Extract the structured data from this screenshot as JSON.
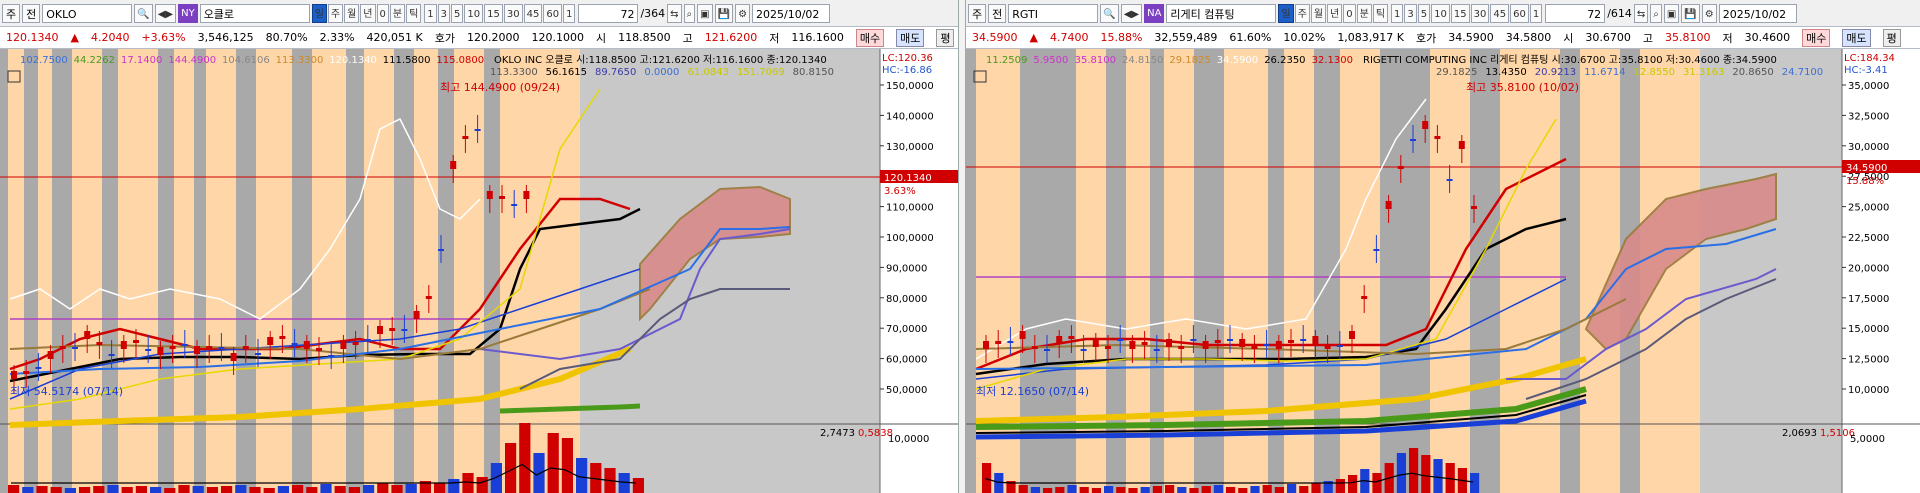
{
  "left": {
    "toolbar": {
      "period": "주",
      "market": "전",
      "symbol": "OKLO",
      "exchange_tag": "NY",
      "stock_name": "오클로",
      "buttons": [
        "일",
        "주",
        "월",
        "년",
        "0",
        "분",
        "틱"
      ],
      "intervals": [
        "1",
        "3",
        "5",
        "10",
        "15",
        "30",
        "45",
        "60",
        "1"
      ],
      "count": "72",
      "total": "/364",
      "date": "2025/10/02"
    },
    "quote": {
      "price": "120.1340",
      "change": "4.2040",
      "change_pct": "+3.63%",
      "volume": "3,546,125",
      "ratio": "80.70%",
      "turnover": "2.33%",
      "amount": "420,051 K",
      "bid_label": "호가",
      "bid": "120.2000",
      "ask": "120.1000",
      "open_label": "시",
      "open": "118.8500",
      "high_label": "고",
      "high": "121.6200",
      "low_label": "저",
      "low": "116.1600",
      "buy": "매수",
      "sell": "매도",
      "flat": "평"
    },
    "legend_row1": {
      "items": [
        {
          "text": "102.7500",
          "color": "#3a6fd6"
        },
        {
          "text": "44.2262",
          "color": "#4a9a1a"
        },
        {
          "text": "17.1400",
          "color": "#cc33cc"
        },
        {
          "text": "144.4900",
          "color": "#cc33cc"
        },
        {
          "text": "104.6106",
          "color": "#888888"
        },
        {
          "text": "113.3300",
          "color": "#cc8a2a"
        },
        {
          "text": "120.1340",
          "color": "#ffffff"
        },
        {
          "text": "111.5800",
          "color": "#000000"
        },
        {
          "text": "115.0800",
          "color": "#d10000"
        }
      ],
      "title": "OKLO INC  오클로 시:118.8500 고:121.6200 저:116.1600 종:120.1340",
      "lc": "LC:120.36",
      "hc": "HC:-16.86"
    },
    "legend_row2": {
      "items": [
        {
          "text": "113.3300",
          "color": "#555555"
        },
        {
          "text": "56.1615",
          "color": "#000000"
        },
        {
          "text": "89.7650",
          "color": "#3a3aa8"
        },
        {
          "text": "0.0000",
          "color": "#3a6fd6"
        },
        {
          "text": "61.0843",
          "color": "#c8c800"
        },
        {
          "text": "151.7069",
          "color": "#c8c800"
        },
        {
          "text": "80.8150",
          "color": "#555555"
        }
      ]
    },
    "max_label": "최고 144.4900 (09/24)",
    "min_label": "최저 54.5174 (07/14)",
    "price_tag": "120.1340",
    "price_pct": "3.63%",
    "y_ticks": [
      "150,0000",
      "140,0000",
      "130,0000",
      "120,0000",
      "110,0000",
      "100,0000",
      "90,0000",
      "80,0000",
      "70,0000",
      "60,0000",
      "50,0000"
    ],
    "vol_legend": [
      "2,7473",
      "0,5838"
    ],
    "vol_tick": "10,0000",
    "accent": "#d10000"
  },
  "right": {
    "toolbar": {
      "period": "주",
      "market": "전",
      "symbol": "RGTI",
      "exchange_tag": "NA",
      "stock_name": "리게티 컴퓨팅",
      "buttons": [
        "일",
        "주",
        "월",
        "년",
        "0",
        "분",
        "틱"
      ],
      "intervals": [
        "1",
        "3",
        "5",
        "10",
        "15",
        "30",
        "45",
        "60",
        "1"
      ],
      "count": "72",
      "total": "/614",
      "date": "2025/10/02"
    },
    "quote": {
      "price": "34.5900",
      "change": "4.7400",
      "change_pct": "15.88%",
      "volume": "32,559,489",
      "ratio": "61.60%",
      "turnover": "10.02%",
      "amount": "1,083,917 K",
      "bid_label": "호가",
      "bid": "34.5900",
      "ask": "34.5800",
      "open_label": "시",
      "open": "30.6700",
      "high_label": "고",
      "high": "35.8100",
      "low_label": "저",
      "low": "30.4600",
      "buy": "매수",
      "sell": "매도",
      "flat": "평"
    },
    "legend_row1": {
      "items": [
        {
          "text": "11.2509",
          "color": "#4a9a1a"
        },
        {
          "text": "5.9500",
          "color": "#cc33cc"
        },
        {
          "text": "35.8100",
          "color": "#cc33cc"
        },
        {
          "text": "24.8150",
          "color": "#888888"
        },
        {
          "text": "29.1825",
          "color": "#cc8a2a"
        },
        {
          "text": "34.5900",
          "color": "#ffffff"
        },
        {
          "text": "26.2350",
          "color": "#000000"
        },
        {
          "text": "32.1300",
          "color": "#d10000"
        }
      ],
      "title": "RIGETTI COMPUTING INC  리게티 컴퓨팅 시:30.6700 고:35.8100 저:30.4600 종:34.5900",
      "lc": "LC:184.34",
      "hc": "HC:-3.41"
    },
    "legend_row2": {
      "items": [
        {
          "text": "29.1825",
          "color": "#555555"
        },
        {
          "text": "13.4350",
          "color": "#000000"
        },
        {
          "text": "20.9213",
          "color": "#3a3aa8"
        },
        {
          "text": "11.6714",
          "color": "#3a6fd6"
        },
        {
          "text": "12.8550",
          "color": "#c8c800"
        },
        {
          "text": "31.3163",
          "color": "#c8c800"
        },
        {
          "text": "20.8650",
          "color": "#555555"
        },
        {
          "text": "24.7100",
          "color": "#3a6fd6"
        }
      ]
    },
    "max_label": "최고 35.8100 (10/02)",
    "min_label": "최저 12.1650 (07/14)",
    "price_tag": "34.5900",
    "price_pct": "15.88%",
    "y_ticks": [
      "35,0000",
      "32,5000",
      "30,0000",
      "27,5000",
      "25,0000",
      "22,5000",
      "20,0000",
      "17,5000",
      "15,0000",
      "12,5000",
      "10,0000"
    ],
    "vol_legend": [
      "2,0693",
      "1,5106"
    ],
    "vol_tick": "5,0000",
    "accent": "#d10000"
  }
}
